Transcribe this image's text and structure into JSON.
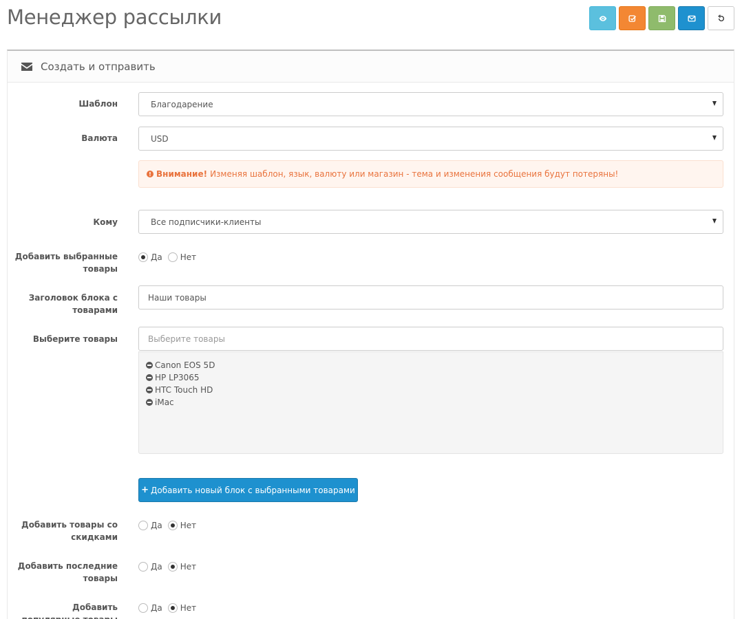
{
  "page": {
    "title": "Менеджер рассылки"
  },
  "toolbar": {
    "preview_icon": "eye-icon",
    "test_icon": "check-square-icon",
    "save_icon": "floppy-icon",
    "send_icon": "envelope-icon",
    "reset_icon": "refresh-icon",
    "colors": {
      "preview": "#5bc0de",
      "test": "#f38733",
      "save": "#8fbb6c",
      "send": "#1e91cf"
    }
  },
  "panel": {
    "heading": "Создать и отправить",
    "heading_icon": "envelope-icon"
  },
  "form": {
    "template": {
      "label": "Шаблон",
      "value": "Благодарение"
    },
    "currency": {
      "label": "Валюта",
      "value": "USD"
    },
    "warning": {
      "strong": "Внимание!",
      "text": "Изменяя шаблон, язык, валюту или магазин - тема и изменения сообщения будут потеряны!"
    },
    "to": {
      "label": "Кому",
      "value": "Все подписчики-клиенты"
    },
    "add_selected": {
      "label": "Добавить выбранные товары",
      "yes": "Да",
      "no": "Нет",
      "selected": "yes"
    },
    "block_title": {
      "label": "Заголовок блока с товарами",
      "value": "Наши товары"
    },
    "choose_products": {
      "label": "Выберите товары",
      "placeholder": "Выберите товары"
    },
    "products": [
      "Canon EOS 5D",
      "HP LP3065",
      "HTC Touch HD",
      "iMac"
    ],
    "add_block_button": "Добавить новый блок с выбранными товарами",
    "add_special": {
      "label": "Добавить товары со скидками",
      "yes": "Да",
      "no": "Нет",
      "selected": "no"
    },
    "add_latest": {
      "label": "Добавить последние товары",
      "yes": "Да",
      "no": "Нет",
      "selected": "no"
    },
    "add_popular": {
      "label": "Добавить популярные товары",
      "yes": "Да",
      "no": "Нет",
      "selected": "no"
    }
  }
}
